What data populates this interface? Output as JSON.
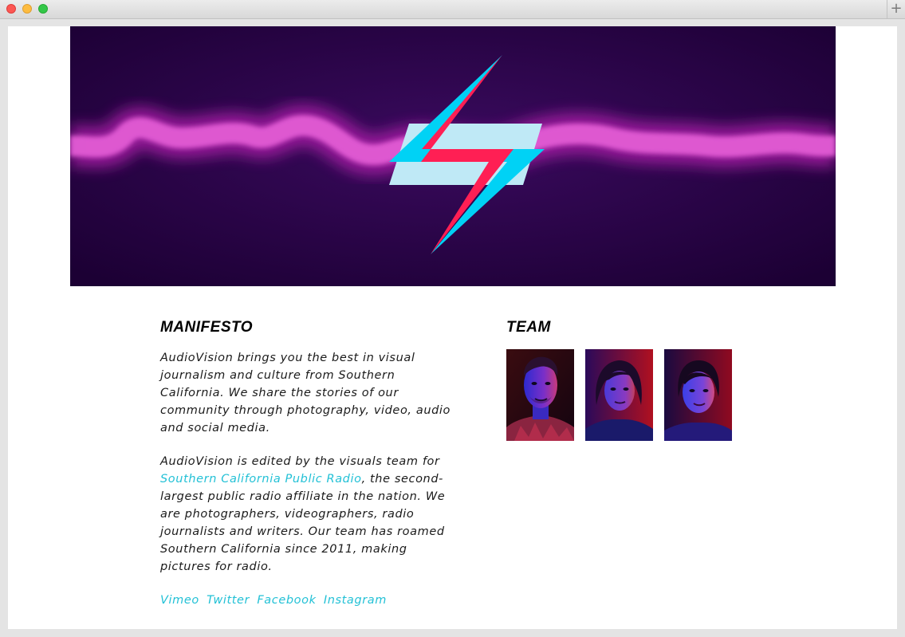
{
  "window": {
    "new_tab_icon": "plus-icon"
  },
  "hero": {
    "logo_icon": "lightning-bolt-icon",
    "colors": {
      "background": "#22003c",
      "glow": "#e25cd4",
      "bolt_red": "#ff1f54",
      "bolt_cyan": "#00d2f5",
      "bolt_light": "#bfe9f6"
    }
  },
  "manifesto": {
    "heading": "MANIFESTO",
    "paragraph1": "AudioVision brings you the best in visual journalism and culture from Southern California. We share the stories of our community through photography, video, audio and social media.",
    "paragraph2_before": "AudioVision is edited by the visuals team for ",
    "paragraph2_link": "Southern California Public Radio",
    "paragraph2_after": ", the second-largest public radio affiliate in the nation. We are photographers, videographers, radio journalists and writers. Our team has roamed Southern California since 2011, making pictures for radio.",
    "social_links": [
      "Vimeo",
      "Twitter",
      "Facebook",
      "Instagram"
    ],
    "link_color": "#23c1d6"
  },
  "team": {
    "heading": "TEAM",
    "members": [
      {
        "photo": "team-member-photo-1"
      },
      {
        "photo": "team-member-photo-2"
      },
      {
        "photo": "team-member-photo-3"
      }
    ]
  }
}
